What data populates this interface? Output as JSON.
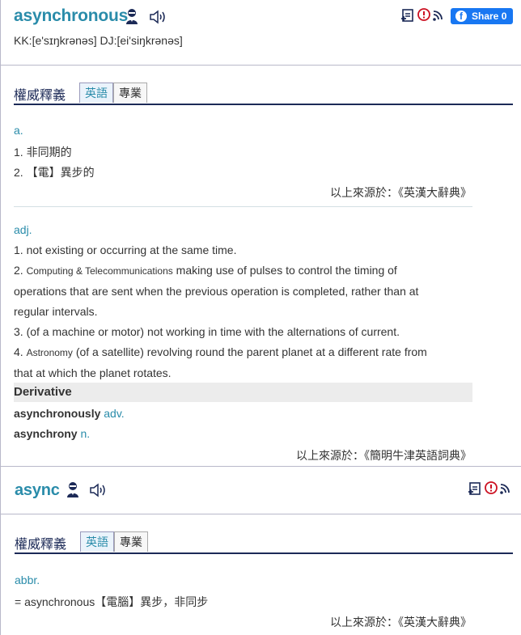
{
  "entry1": {
    "word": "asynchronous",
    "pronunciation": "KK:[e'sɪŋkrənəs] DJ:[ei'siŋkrənəs]",
    "share": {
      "label": "Share",
      "count": "0"
    },
    "section_title": "權威釋義",
    "tabs": [
      "英語",
      "專業"
    ],
    "block1": {
      "pos": "a.",
      "senses": [
        "1. 非同期的",
        "2. 【電】異步的"
      ],
      "source": "以上來源於：《英漢大辭典》"
    },
    "block2": {
      "pos": "adj.",
      "sense1": "1. not existing or occurring at the same time.",
      "sense2_num": "2.",
      "sense2_label": "Computing & Telecommunications",
      "sense2_line1": "making use of pulses to control the timing of",
      "sense2_line2": "operations that are sent when the previous operation is completed, rather than at",
      "sense2_line3": "regular intervals.",
      "sense3": "3. (of a machine or motor) not working in time with the alternations of current.",
      "sense4_num": "4.",
      "sense4_label": "Astronomy",
      "sense4_line1": "(of a satellite) revolving round the parent planet at a different rate from",
      "sense4_line2": "that at which the planet rotates.",
      "derivative_title": "Derivative",
      "derivatives": [
        {
          "word": "asynchronously",
          "pos": "adv."
        },
        {
          "word": "asynchrony",
          "pos": "n."
        }
      ],
      "source": "以上來源於：《簡明牛津英語詞典》"
    }
  },
  "entry2": {
    "word": "async",
    "section_title": "權威釋義",
    "tabs": [
      "英語",
      "專業"
    ],
    "pos": "abbr.",
    "sense": "= asynchronous【電腦】異步，非同步",
    "source": "以上來源於：《英漢大辭典》"
  },
  "colors": {
    "accent": "#2a8caa",
    "navy": "#1c2a57",
    "facebook": "#1877f2",
    "alert": "#cc1122"
  },
  "icons": [
    "person-icon",
    "speaker-icon",
    "add-note-icon",
    "alert-icon",
    "rss-icon",
    "facebook-icon"
  ]
}
